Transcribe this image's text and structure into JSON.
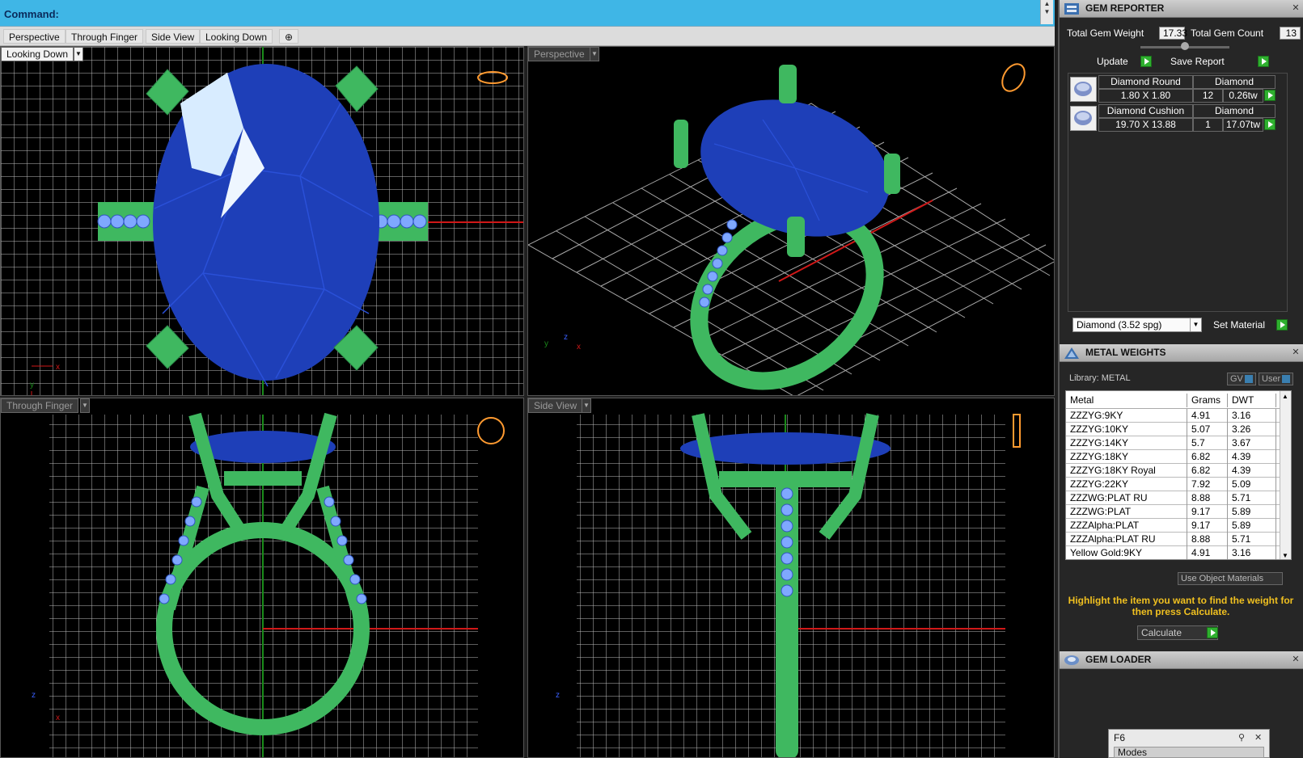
{
  "command_bar": {
    "label": "Command:"
  },
  "viewport_tabs": [
    "Perspective",
    "Through Finger",
    "Side View",
    "Looking Down",
    "⊕"
  ],
  "viewports": {
    "top_left": {
      "label": "Looking Down"
    },
    "top_right": {
      "label": "Perspective"
    },
    "bottom_left": {
      "label": "Through Finger"
    },
    "bottom_right": {
      "label": "Side View"
    }
  },
  "gem_reporter": {
    "title": "GEM REPORTER",
    "total_weight_label": "Total Gem Weight",
    "total_weight_value": "17.33",
    "total_count_label": "Total Gem Count",
    "total_count_value": "13",
    "update_label": "Update",
    "save_report_label": "Save Report",
    "gems": [
      {
        "shape": "Diamond Round",
        "material": "Diamond",
        "size": "1.80 X 1.80",
        "count": "12",
        "weight": "0.26tw"
      },
      {
        "shape": "Diamond Cushion",
        "material": "Diamond",
        "size": "19.70 X 13.88",
        "count": "1",
        "weight": "17.07tw"
      }
    ],
    "material_select": "Diamond    (3.52 spg)",
    "set_material_label": "Set Material"
  },
  "metal_weights": {
    "title": "METAL WEIGHTS",
    "library_label": "Library: METAL",
    "gv_label": "GV",
    "user_label": "User",
    "columns": [
      "Metal",
      "Grams",
      "DWT"
    ],
    "rows": [
      [
        "ZZZYG:9KY",
        "4.91",
        "3.16"
      ],
      [
        "ZZZYG:10KY",
        "5.07",
        "3.26"
      ],
      [
        "ZZZYG:14KY",
        "5.7",
        "3.67"
      ],
      [
        "ZZZYG:18KY",
        "6.82",
        "4.39"
      ],
      [
        "ZZZYG:18KY Royal",
        "6.82",
        "4.39"
      ],
      [
        "ZZZYG:22KY",
        "7.92",
        "5.09"
      ],
      [
        "ZZZWG:PLAT RU",
        "8.88",
        "5.71"
      ],
      [
        "ZZZWG:PLAT",
        "9.17",
        "5.89"
      ],
      [
        "ZZZAlpha:PLAT",
        "9.17",
        "5.89"
      ],
      [
        "ZZZAlpha:PLAT RU",
        "8.88",
        "5.71"
      ],
      [
        "Yellow Gold:9KY",
        "4.91",
        "3.16"
      ]
    ],
    "use_object_materials_label": "Use Object Materials",
    "hint": "Highlight the item you want to find the weight for then press Calculate.",
    "calculate_label": "Calculate"
  },
  "gem_loader": {
    "title": "GEM LOADER"
  },
  "f6_panel": {
    "title": "F6",
    "modes_label": "Modes"
  },
  "colors": {
    "metal": "#3fb860",
    "gem": "#1e3fb8",
    "grid": "#cfcfcf",
    "command_bar": "#3fb6e6",
    "hint": "#f0c020"
  }
}
